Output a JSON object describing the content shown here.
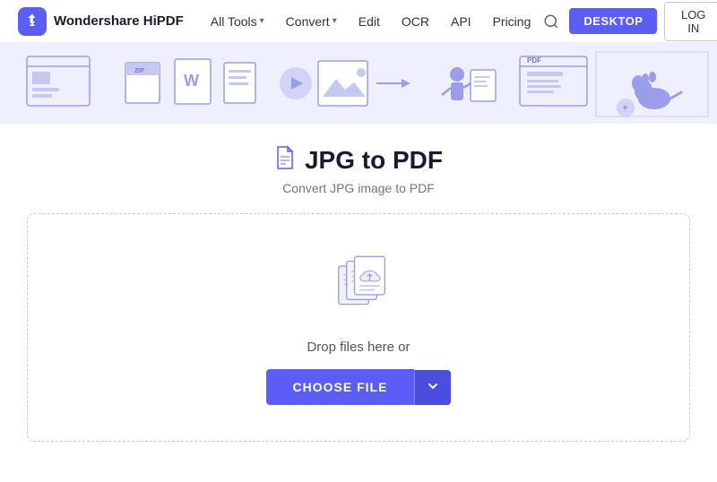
{
  "app": {
    "name": "Wondershare HiPDF"
  },
  "navbar": {
    "logo_text": "Wondershare HiPDF",
    "all_tools_label": "All Tools",
    "convert_label": "Convert",
    "edit_label": "Edit",
    "ocr_label": "OCR",
    "api_label": "API",
    "pricing_label": "Pricing",
    "desktop_btn": "DESKTOP",
    "login_btn": "LOG IN"
  },
  "page": {
    "icon": "📄",
    "title": "JPG to PDF",
    "subtitle": "Convert JPG image to PDF",
    "drop_text": "Drop files here or",
    "choose_file_label": "CHOOSE FILE"
  }
}
